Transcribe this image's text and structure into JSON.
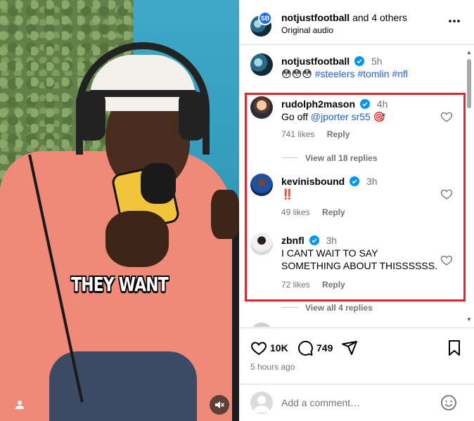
{
  "video": {
    "caption": "THEY WANT"
  },
  "header": {
    "account": "notjustfootball",
    "others": "and 4 others",
    "audio": "Original audio",
    "avatar_badge": "SB"
  },
  "post": {
    "username": "notjustfootball",
    "time": "5h",
    "emojis": "😳😳😳",
    "hashtags": "#steelers #tomlin #nfl"
  },
  "comments": [
    {
      "username": "rudolph2mason",
      "time": "4h",
      "text_prefix": "Go off ",
      "mention": "@jporter sr55",
      "emoji": "🎯",
      "likes": "741 likes",
      "reply": "Reply",
      "view_replies": "View all 18 replies"
    },
    {
      "username": "kevinisbound",
      "time": "3h",
      "text": "‼️",
      "likes": "49 likes",
      "reply": "Reply"
    },
    {
      "username": "zbnfl",
      "time": "3h",
      "text": "I CANT WAIT TO SAY SOMETHING ABOUT THISSSSSS.",
      "likes": "72 likes",
      "reply": "Reply",
      "view_replies": "View all 4 replies"
    }
  ],
  "actions": {
    "like_count": "10K",
    "comment_count": "749",
    "timestamp": "5 hours ago"
  },
  "composer": {
    "placeholder": "Add a comment…"
  },
  "colors": {
    "highlight": "#e3262d",
    "verified": "#0095f6",
    "hashtag": "#1f5dd0"
  }
}
